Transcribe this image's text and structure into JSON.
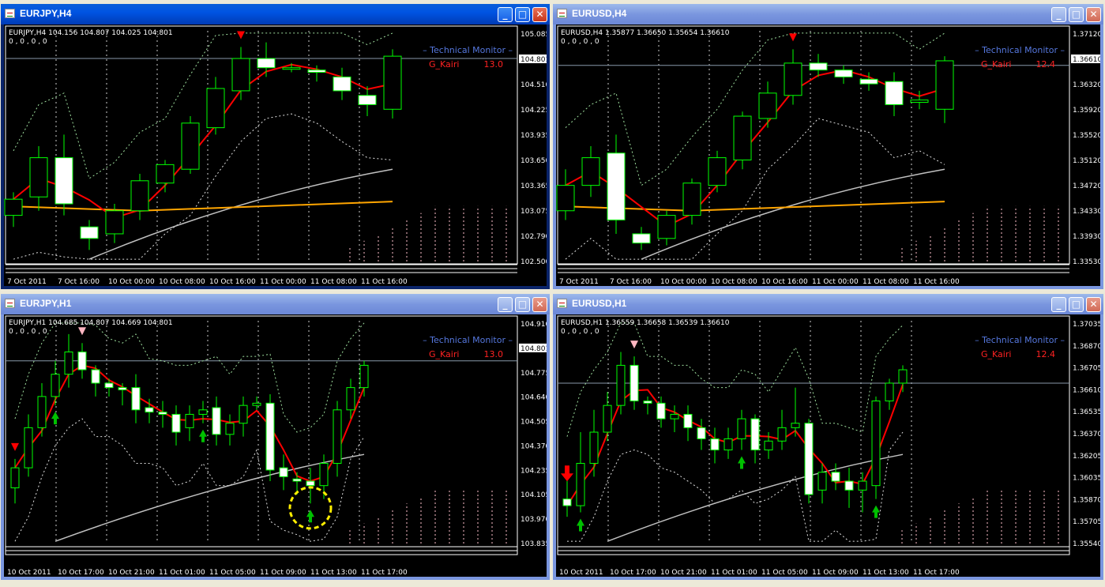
{
  "windows": [
    {
      "id": "w1",
      "title": "EURJPY,H4",
      "active": true,
      "info": "EURJPY,H4  104.156 104.807 104.025 104.801",
      "info2": "0 , 0 , 0 , 0",
      "monitor": "Technical  Monitor",
      "kairi_label": "G_Kairi",
      "kairi_value": "13.0",
      "price_labels": [
        "105.085",
        "104.801",
        "104.510",
        "104.225",
        "103.935",
        "103.650",
        "103.365",
        "103.075",
        "102.790",
        "102.500"
      ],
      "current_price": "104.801",
      "time_labels": [
        "7 Oct 2011",
        "7 Oct 16:00",
        "10 Oct 00:00",
        "10 Oct 08:00",
        "10 Oct 16:00",
        "11 Oct 00:00",
        "11 Oct 08:00",
        "11 Oct 16:00"
      ]
    },
    {
      "id": "w2",
      "title": "EURUSD,H4",
      "active": false,
      "info": "EURUSD,H4  1.35877 1.36650 1.35654 1.36610",
      "info2": "0 , 0 , 0 , 0",
      "monitor": "Technical  Monitor",
      "kairi_label": "G_Kairi",
      "kairi_value": "12.4",
      "price_labels": [
        "1.37120",
        "1.36610",
        "1.36320",
        "1.35920",
        "1.35520",
        "1.35120",
        "1.34720",
        "1.34330",
        "1.33930",
        "1.33530"
      ],
      "current_price": "1.36610",
      "time_labels": [
        "7 Oct 2011",
        "7 Oct 16:00",
        "10 Oct 00:00",
        "10 Oct 08:00",
        "10 Oct 16:00",
        "11 Oct 00:00",
        "11 Oct 08:00",
        "11 Oct 16:00"
      ]
    },
    {
      "id": "w3",
      "title": "EURJPY,H1",
      "active": false,
      "info": "EURJPY,H1  104.685 104.807 104.669 104.801",
      "info2": "0 , 0 , 0 , 0",
      "monitor": "Technical  Monitor",
      "kairi_label": "G_Kairi",
      "kairi_value": "13.0",
      "price_labels": [
        "104.910",
        "104.801",
        "104.775",
        "104.640",
        "104.505",
        "104.370",
        "104.235",
        "104.105",
        "103.970",
        "103.835"
      ],
      "current_price": "104.801",
      "time_labels": [
        "10 Oct 2011",
        "10 Oct 17:00",
        "10 Oct 21:00",
        "11 Oct 01:00",
        "11 Oct 05:00",
        "11 Oct 09:00",
        "11 Oct 13:00",
        "11 Oct 17:00"
      ]
    },
    {
      "id": "w4",
      "title": "EURUSD,H1",
      "active": false,
      "info": "EURUSD,H1  1.36559 1.36658 1.36539 1.36610",
      "info2": "0 , 0 , 0 , 0",
      "monitor": "Technical  Monitor",
      "kairi_label": "G_Kairi",
      "kairi_value": "12.4",
      "price_labels": [
        "1.37035",
        "1.36870",
        "1.36705",
        "1.36610",
        "1.36535",
        "1.36370",
        "1.36205",
        "1.36035",
        "1.35870",
        "1.35705",
        "1.35540"
      ],
      "current_price": "1.36610",
      "time_labels": [
        "10 Oct 2011",
        "10 Oct 17:00",
        "10 Oct 21:00",
        "11 Oct 01:00",
        "11 Oct 05:00",
        "11 Oct 09:00",
        "11 Oct 13:00",
        "11 Oct 17:00"
      ]
    }
  ],
  "buttons": {
    "minimize": "_",
    "maximize": "□",
    "close": "✕"
  },
  "colors": {
    "bull": "#00ff00",
    "bear": "#ffffff",
    "ma_fast": "#ff0000",
    "ma_slow": "#c0c0c0",
    "ma_orange": "#ffa500",
    "band": "#ffc0cb",
    "signal_sell": "#ff0000",
    "signal_buy": "#00c000",
    "grid": "#ffffff",
    "price_axis": "#ffffff"
  }
}
